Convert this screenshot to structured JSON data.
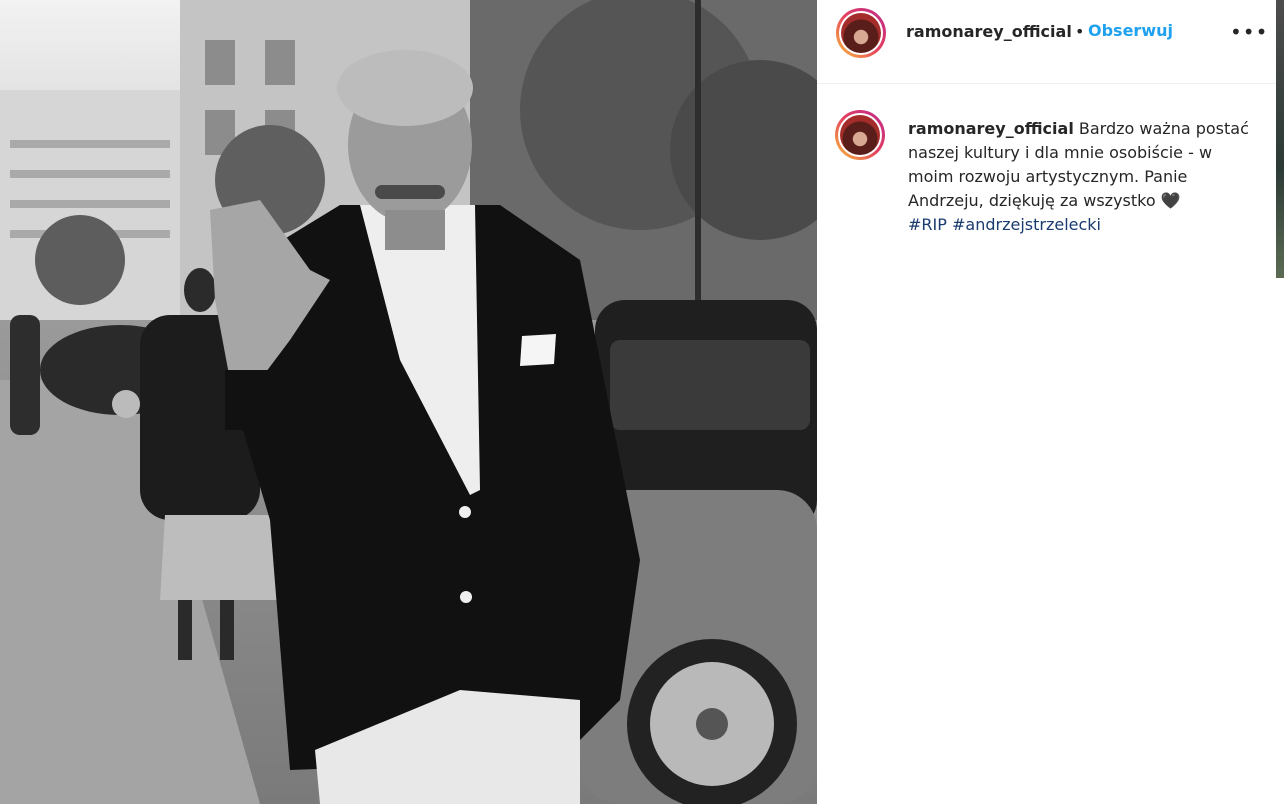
{
  "post": {
    "image_alt": "black and white street photo of a man in a blazer waving"
  },
  "header": {
    "username": "ramonarey_official",
    "separator": "•",
    "follow_label": "Obserwuj",
    "more_label": "•••"
  },
  "caption": {
    "username": "ramonarey_official",
    "text": "Bardzo ważna postać naszej kultury i dla mnie osobiście - w moim rozwoju artystycznym. Panie Andrzeju, dziękuję za wszystko 🖤",
    "hashtags": [
      "#RIP",
      "#andrzejstrzelecki"
    ]
  },
  "colors": {
    "follow": "#1fa1f0",
    "hashtag": "#1a3b6e",
    "text": "#262626"
  },
  "icons": {
    "more": "more-options-icon"
  }
}
